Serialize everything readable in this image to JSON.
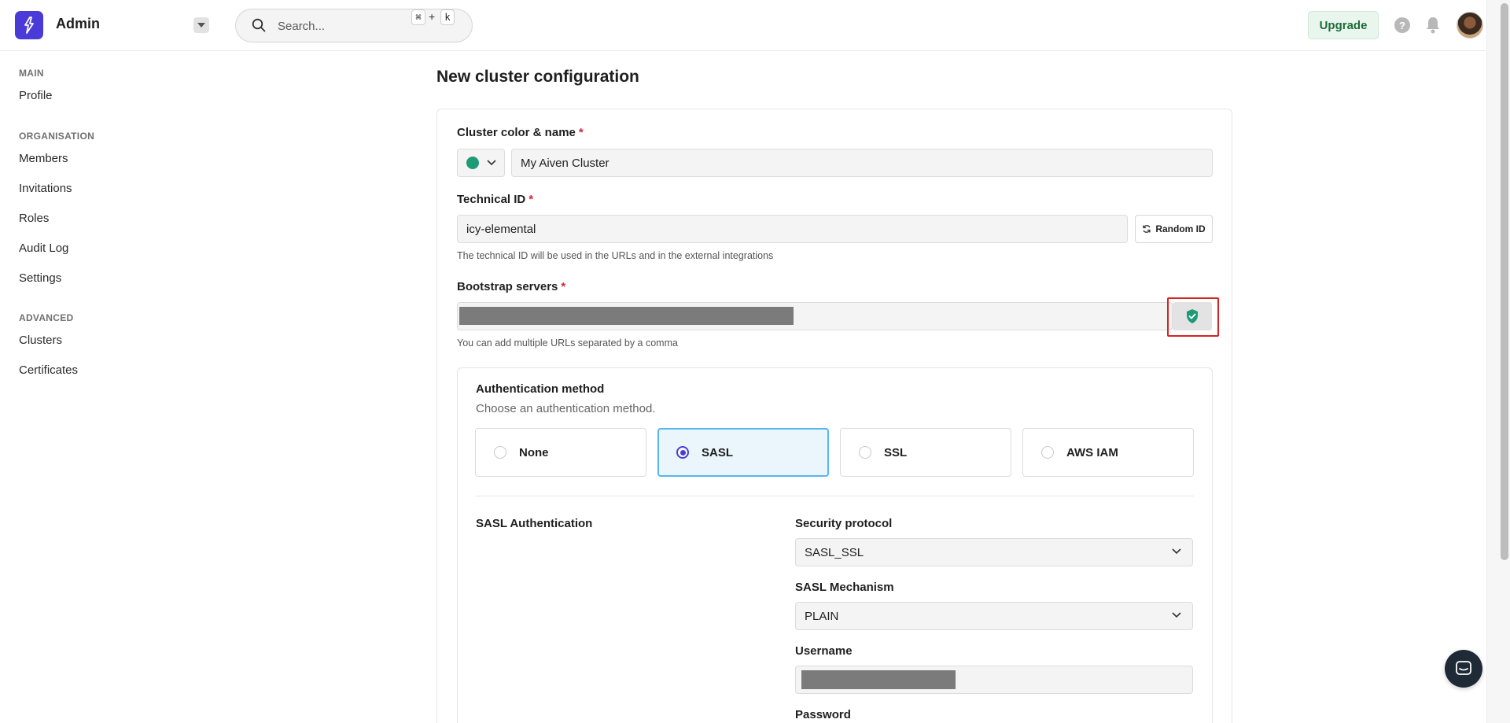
{
  "header": {
    "app_title": "Admin",
    "search": {
      "placeholder": "Search...",
      "shortcut_key1": "⌘",
      "shortcut_plus": "+",
      "shortcut_key2": "k"
    },
    "upgrade_label": "Upgrade",
    "help_label": "?"
  },
  "sidebar": {
    "sections": [
      {
        "title": "MAIN",
        "items": [
          "Profile"
        ]
      },
      {
        "title": "ORGANISATION",
        "items": [
          "Members",
          "Invitations",
          "Roles",
          "Audit Log",
          "Settings"
        ]
      },
      {
        "title": "ADVANCED",
        "items": [
          "Clusters",
          "Certificates"
        ]
      }
    ]
  },
  "main": {
    "page_title": "New cluster configuration",
    "cluster_name": {
      "label": "Cluster color & name",
      "required": "*",
      "value": "My Aiven Cluster",
      "color": "#1d9a77"
    },
    "technical_id": {
      "label": "Technical ID",
      "required": "*",
      "value": "icy-elemental",
      "random_label": "Random ID",
      "helper": "The technical ID will be used in the URLs and in the external integrations"
    },
    "bootstrap": {
      "label": "Bootstrap servers",
      "required": "*",
      "helper": "You can add multiple URLs separated by a comma"
    },
    "auth": {
      "title": "Authentication method",
      "subtitle": "Choose an authentication method.",
      "options": [
        "None",
        "SASL",
        "SSL",
        "AWS IAM"
      ],
      "selected": "SASL"
    },
    "sasl": {
      "title": "SASL Authentication",
      "security_protocol": {
        "label": "Security protocol",
        "value": "SASL_SSL"
      },
      "mechanism": {
        "label": "SASL Mechanism",
        "value": "PLAIN"
      },
      "username": {
        "label": "Username"
      },
      "password": {
        "label": "Password"
      }
    }
  },
  "colors": {
    "brand": "#4a3ad8",
    "accent_selected": "#58b6ee",
    "required": "#d7263d",
    "success": "#1d9a77",
    "highlight": "#d42424"
  }
}
